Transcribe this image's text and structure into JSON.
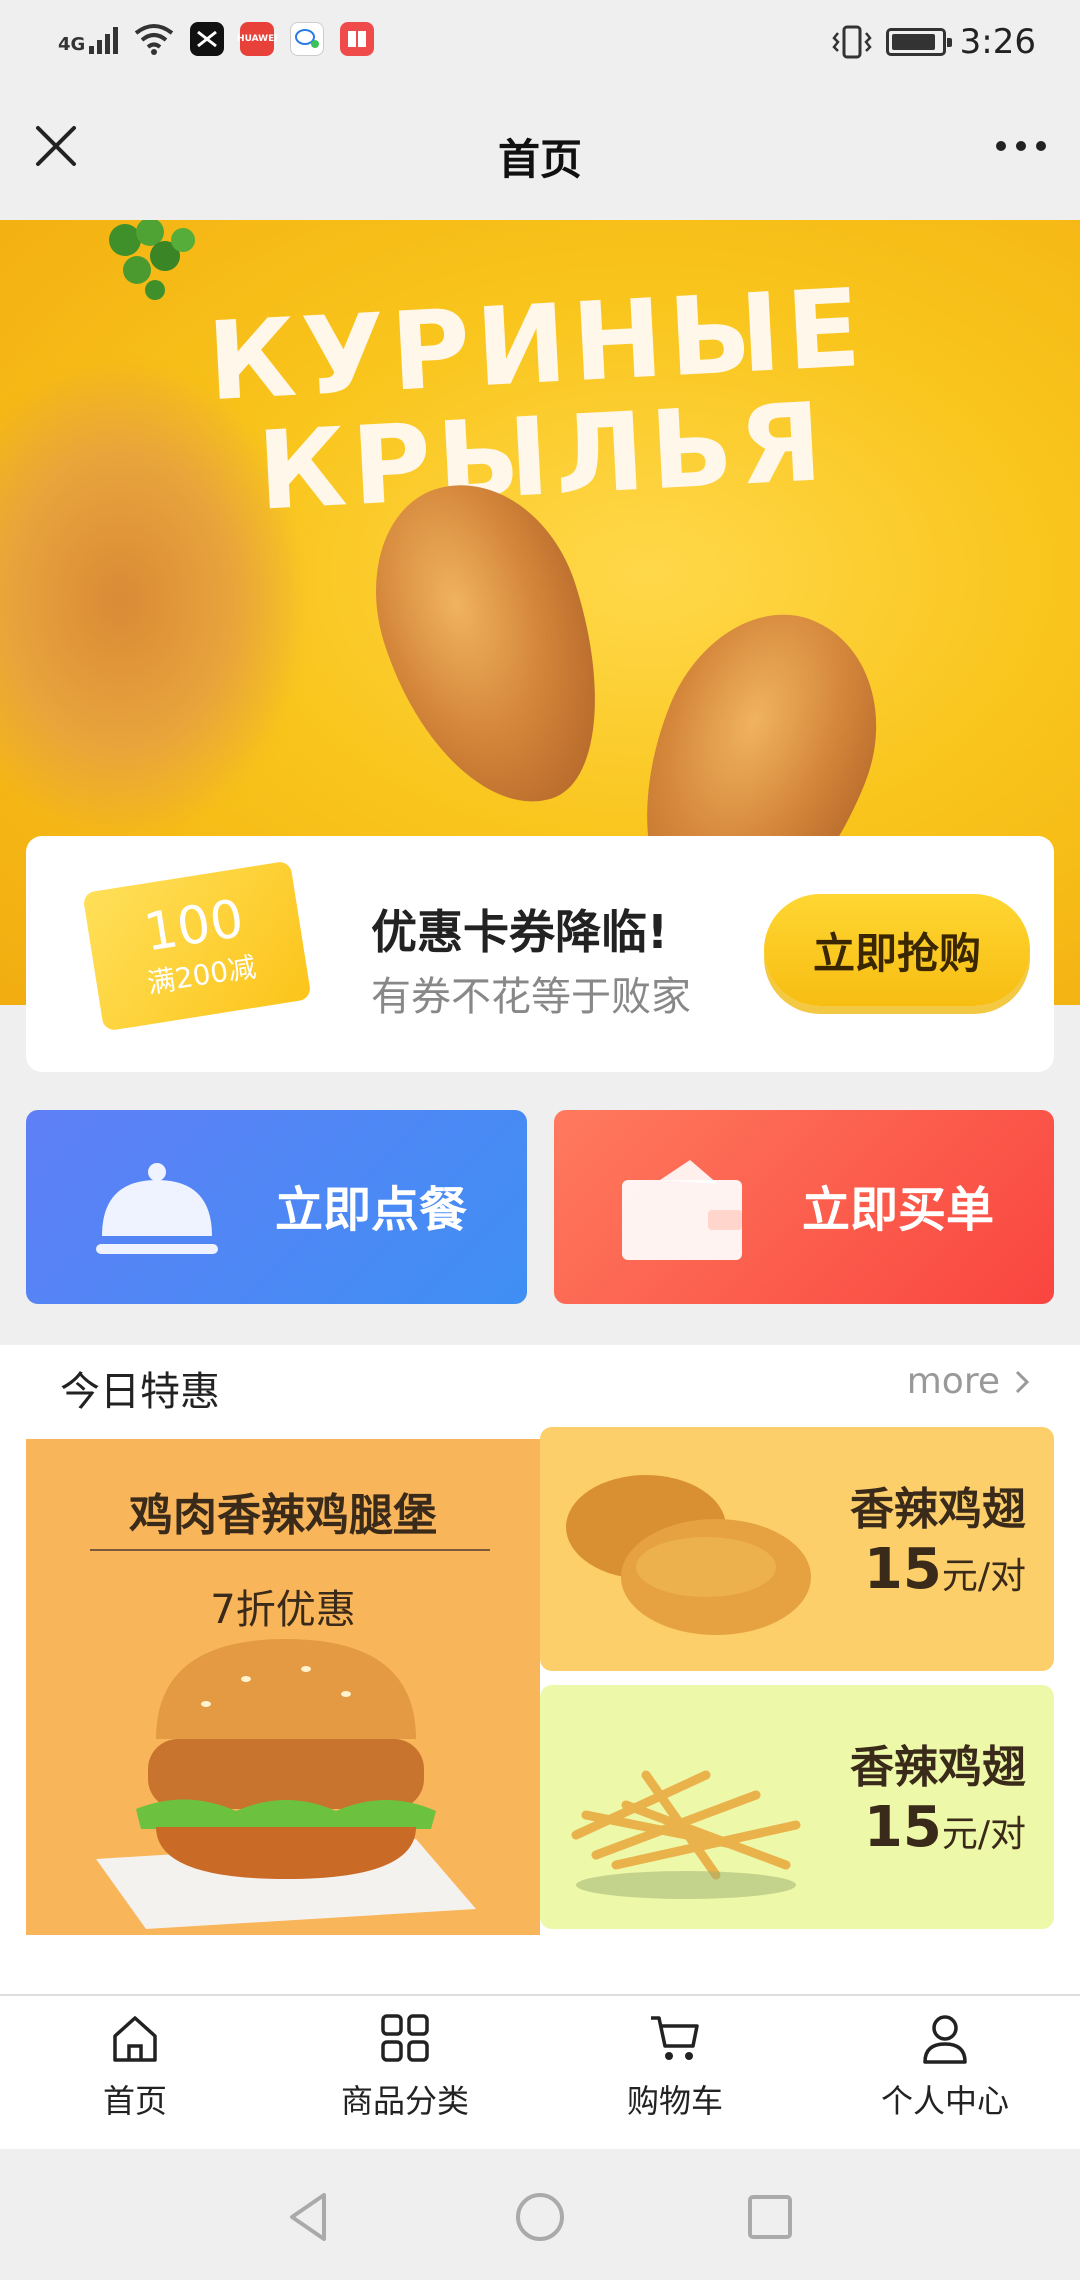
{
  "status_bar": {
    "network": "4G",
    "apps": [
      "剪映",
      "HUAWEI",
      "消息",
      "阅读"
    ],
    "time": "3:26",
    "battery_level_percent": 90,
    "icons": [
      "signal-icon",
      "wifi-icon",
      "vibrate-icon",
      "battery-icon"
    ]
  },
  "header": {
    "title": "首页",
    "close_icon": "close-icon",
    "more_icon": "more-icon"
  },
  "banner": {
    "line1": "КУРИНЫЕ",
    "line2": "КРЫЛЬЯ"
  },
  "coupon": {
    "amount": "100",
    "condition": "满200减",
    "title": "优惠卡券降临!",
    "subtitle": "有券不花等于败家",
    "button": "立即抢购"
  },
  "actions": {
    "order_label": "立即点餐",
    "pay_label": "立即买单"
  },
  "today_deals": {
    "title": "今日特惠",
    "more": "more",
    "featured": {
      "name": "鸡肉香辣鸡腿堡",
      "discount": "7折优惠"
    },
    "items": [
      {
        "name": "香辣鸡翅",
        "price": "15",
        "unit": "元/对"
      },
      {
        "name": "香辣鸡翅",
        "price": "15",
        "unit": "元/对"
      }
    ]
  },
  "tabbar": {
    "items": [
      {
        "label": "首页",
        "icon": "home-icon"
      },
      {
        "label": "商品分类",
        "icon": "grid-icon"
      },
      {
        "label": "购物车",
        "icon": "cart-icon"
      },
      {
        "label": "个人中心",
        "icon": "user-icon"
      }
    ]
  },
  "system_nav": [
    "back-icon",
    "home-circle-icon",
    "recents-icon"
  ],
  "colors": {
    "banner_yellow": "#f9c51c",
    "button_yellow": "#fcc41a",
    "order_blue": "#4a88f5",
    "pay_red": "#f9453f"
  }
}
